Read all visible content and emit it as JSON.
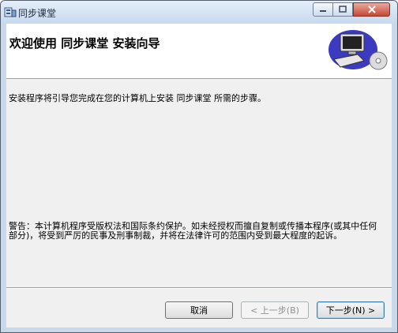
{
  "window": {
    "title": "同步课堂",
    "controls": {
      "minimize": "─",
      "maximize": "□",
      "close": "✕"
    }
  },
  "header": {
    "title": "欢迎使用  同步课堂  安装向导"
  },
  "body": {
    "intro": "安装程序将引导您完成在您的计算机上安装  同步课堂  所需的步骤。",
    "warning": "警告：本计算机程序受版权法和国际条约保护。如未经授权而擅自复制或传播本程序(或其中任何部分)，将受到严厉的民事及刑事制裁，并将在法律许可的范围内受到最大程度的起诉。"
  },
  "buttons": {
    "cancel": "取消",
    "prev": "< 上一步(B)",
    "next": "下一步(N) >"
  },
  "icons": {
    "app": "installer-icon",
    "wizard": "computer-cd-icon"
  },
  "colors": {
    "title_bar": "#c8d9ee",
    "close_button": "#c64838",
    "panel": "#f0f0f0"
  }
}
